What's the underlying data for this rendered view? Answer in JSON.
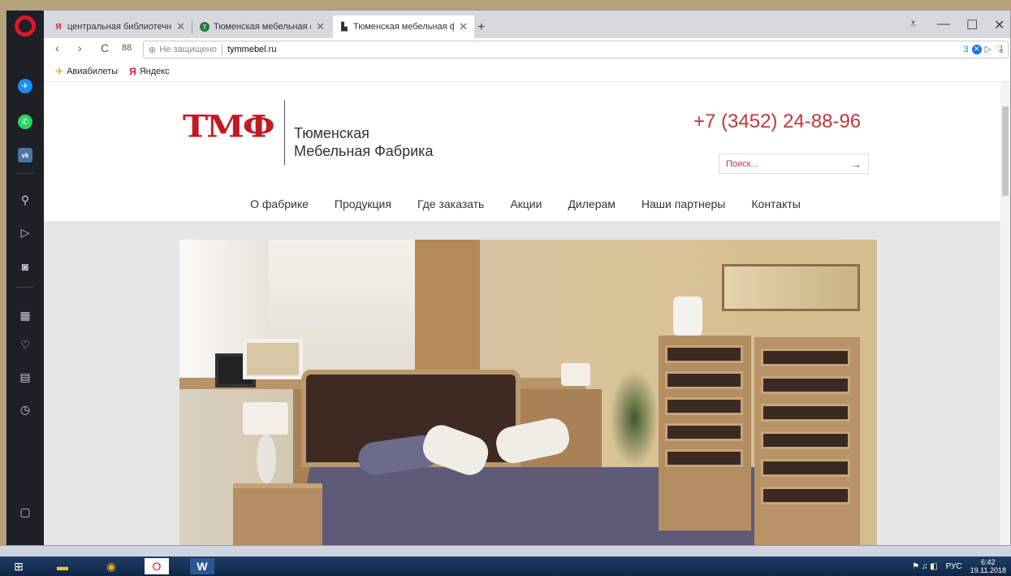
{
  "tabs": [
    {
      "label": "центральная библиотечн",
      "favicon": "yandex-icon",
      "active": false
    },
    {
      "label": "Тюменская мебельная ф",
      "favicon": "site-icon",
      "active": false
    },
    {
      "label": "Тюменская мебельная ф",
      "favicon": "page-icon",
      "active": true
    }
  ],
  "new_tab": "+",
  "window_controls": {
    "menu": "⩡",
    "minimize": "—",
    "maximize": "☐",
    "close": "✕"
  },
  "addr": {
    "back": "‹",
    "forward": "›",
    "reload": "C",
    "speed_dial": "88",
    "security_text": "Не защищено",
    "url": "tymmebel.ru",
    "badge_count": "3"
  },
  "bookmarks": [
    {
      "label": "Авиабилеты",
      "icon": "plane-icon"
    },
    {
      "label": "Яндекс",
      "icon": "yandex-icon"
    }
  ],
  "site": {
    "logo_text": "ТМФ",
    "company_line1": "Тюменская",
    "company_line2": "Мебельная Фабрика",
    "phone": "+7 (3452) 24-88-96",
    "search_placeholder": "Поиск...",
    "menu": [
      "О фабрике",
      "Продукция",
      "Где заказать",
      "Акции",
      "Дилерам",
      "Наши партнеры",
      "Контакты"
    ]
  },
  "taskbar": {
    "time": "6:42",
    "date": "19.11.2018",
    "lang": "РУС"
  },
  "colors": {
    "brand_red": "#c11a22",
    "phone_red": "#c0373a",
    "sidebar": "#1d2024"
  }
}
